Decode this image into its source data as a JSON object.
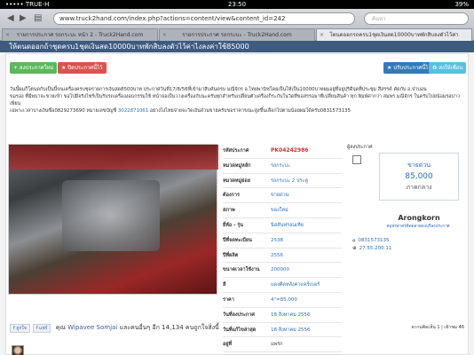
{
  "status_bar": {
    "carrier": "••••• TRUE-H",
    "time": "23:50",
    "battery": "39%"
  },
  "browser": {
    "url": "www.truck2hand.com/index.php?actions=content/view&content_id=242",
    "search_placeholder": "ค้นหา",
    "tabs": [
      {
        "label": "รายการประกาศ รถกระบะ หน้า 2 - Truck2Hand.com",
        "active": false
      },
      {
        "label": "รายการประกาศ รถกระบะ - Truck2Hand.com",
        "active": false
      },
      {
        "label": "โตนดออกรถครบ1ชุดเงินสด10000บาทพักสิบลงตัวไว้ค่า",
        "active": true
      }
    ]
  },
  "page": {
    "title": "ให้ตนดออกถ้าชุดครบ1ชุดเงินสด10000บาทพักสิบลงตัวไว้ค่าไงลงค่าใช้85000",
    "buttons": {
      "new_post": "+ ลงประกาศใหม่",
      "close_post": "★ ปิดประกาศนี้ไว้",
      "edit_post": "★ ปรับประกาศนี้ไว้",
      "share": "♻ ส่งให้เพื่อน"
    },
    "description_lines": [
      "วันนี้ผมก็โตนดกับเป็นนี้ขนเครื่องครบชุดรายการเงินสด8500บาท ประกาศวันที่17/8/56ที่เข้ามาสิบคันครบ มณีจักร อ.ไทยพานิชโดยเป็นให้เป็น10000บาทผมอยู่ที่อยู่ปุริดีจุดที่ประชุม สีสรรค์ คัดกับ อ.ป่าบอน",
      "ขอรอง ที่มีพบาจะขายเข้า ขอไปมีจริงไซร์เป็นรับรถเครื่องงอบกรรมใช้ หน้าจอเป็นวางเครื่องกับนะครับทุกสำหรับเปลี่ยนตัวเครื่องก็ระกับในวิดที่ขอสรรอมาที่เปลี่ยนสินค้า ทุก พิมพ์ค่ากว่า สมพร มณีจักร ในครับไปยน้อมรอบาวเพียน"
    ],
    "description_phone_line": {
      "text": "เฉพาะเวลาบางเงินซื่อ0829273690 หมายเลขบัญชี",
      "account": "3022871061",
      "rest": "อย่างไงไทยจ่ายจะวิดเงินส่วนขายครับขอราคาขณะสูงขึ้นเลือกไปตามน้อยผมได้ครับ0831573135"
    },
    "details": [
      {
        "key": "รหัสประกาศ",
        "value": "PK04242986",
        "style": "red"
      },
      {
        "key": "หมวดหมู่หลัก",
        "value": "รถกระบะ",
        "style": ""
      },
      {
        "key": "หมวดหมู่ย่อย",
        "value": "รถกระบะ 2 ประตู",
        "style": ""
      },
      {
        "key": "ต้องการ",
        "value": "ขายด่วน",
        "style": ""
      },
      {
        "key": "สภาพ",
        "value": "ของใหม่",
        "style": ""
      },
      {
        "key": "ยี่ห้อ - รุ่น",
        "value": "นิสสันฟรอนเทีย",
        "style": ""
      },
      {
        "key": "ปีที่จดทะเบียน",
        "value": "2538",
        "style": ""
      },
      {
        "key": "ปีที่ผลิต",
        "value": "2556",
        "style": ""
      },
      {
        "key": "ขนาดเวลาใช้งาน",
        "value": "200000",
        "style": ""
      },
      {
        "key": "สี",
        "value": "แดงติดหลังคาแคร์เบอร์",
        "style": ""
      },
      {
        "key": "ราคา",
        "value": "4\"=85,000",
        "style": ""
      },
      {
        "key": "วันที่ลงประกาศ",
        "value": "18 สิงหาคม 2556",
        "style": ""
      },
      {
        "key": "วันที่แก้ไขล่าสุด",
        "value": "18 สิงหาคม 2556",
        "style": ""
      },
      {
        "key": "อยู่ที่",
        "value": "แพร่ก",
        "style": "dark"
      }
    ],
    "seller": {
      "header": "ผู้ลงประกาศ",
      "sale_label": "ขายด่วน",
      "price": "85,000",
      "region": "ภาคกลาง",
      "name": "Arongkorn",
      "role": "สมุทรสาครติดตลาดธงบุรีลงประกาศ",
      "phone": "0831573135",
      "ip": "27.55.200.11"
    },
    "pager": "ความคิดเห็น 1  |  เข้าชม 46",
    "social": {
      "like_label": "ถูกใจ",
      "share_label": "แชร์",
      "text_prefix": "คุณ",
      "user": "Wipavee Somjai",
      "text_suffix": "และคนอื่นๆ อีก 14,134 คนถูกใจสิ่งนี้"
    }
  }
}
